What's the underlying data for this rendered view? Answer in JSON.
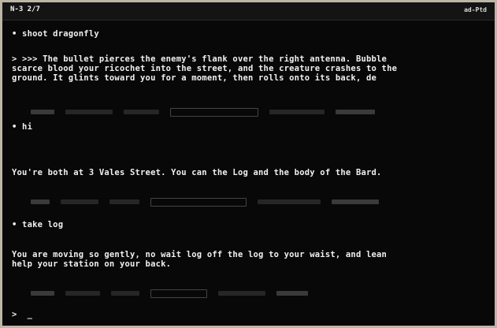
{
  "statusbar": {
    "left": "N-3  2/7",
    "right": "ad-Ptd"
  },
  "scene": {
    "heading": "• shoot dragonfly",
    "description": [
      "> >>> The bullet pierces the enemy's flank over the right antenna. Bubble",
      "scarce blood your ricochet into the street, and the creature crashes to the",
      "ground. It glints toward you for a moment, then rolls onto its back, de"
    ]
  },
  "prompt1": {
    "char": "• hi"
  },
  "response1": "You're both at 3 Vales Street. You can the Log and the body of the Bard.",
  "prompt2": {
    "char": "• take log"
  },
  "response2": [
    "You are moving so gently, no wait log off the log to your waist, and lean",
    "help your station on your back."
  ],
  "prompt3": {
    "char": ">  _"
  }
}
